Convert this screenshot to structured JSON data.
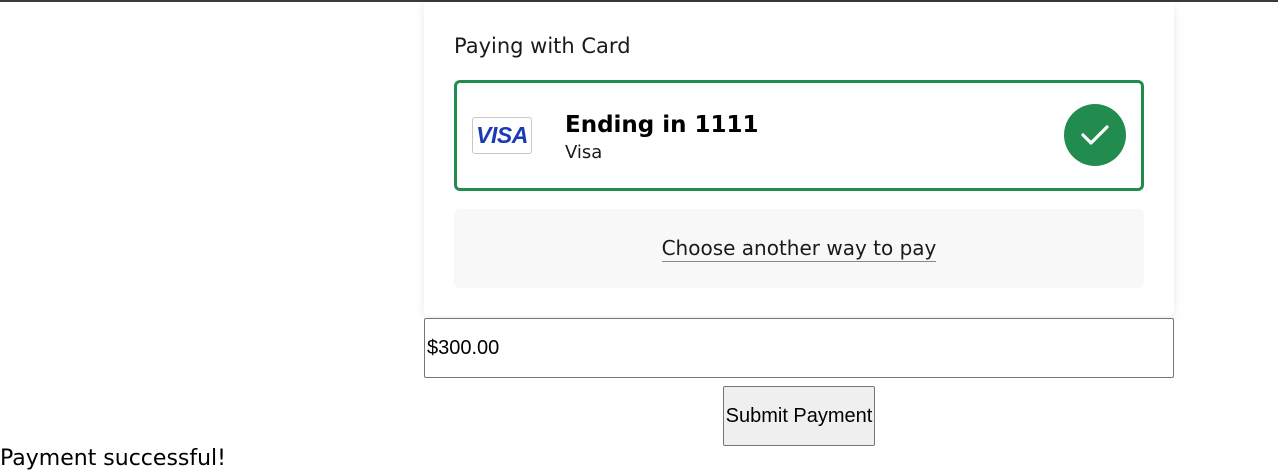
{
  "panel": {
    "title": "Paying with Card",
    "selected_card": {
      "brand_logo_text": "VISA",
      "ending": "Ending in 1111",
      "brand": "Visa",
      "selected_icon": "checkmark-circle-icon"
    },
    "alternate_link": "Choose another way to pay"
  },
  "payment": {
    "amount_value": "$300.00",
    "submit_label": "Submit Payment"
  },
  "status": {
    "message": "Payment successful!"
  },
  "colors": {
    "accent_green": "#228b4e",
    "visa_blue": "#1a3bb3"
  }
}
